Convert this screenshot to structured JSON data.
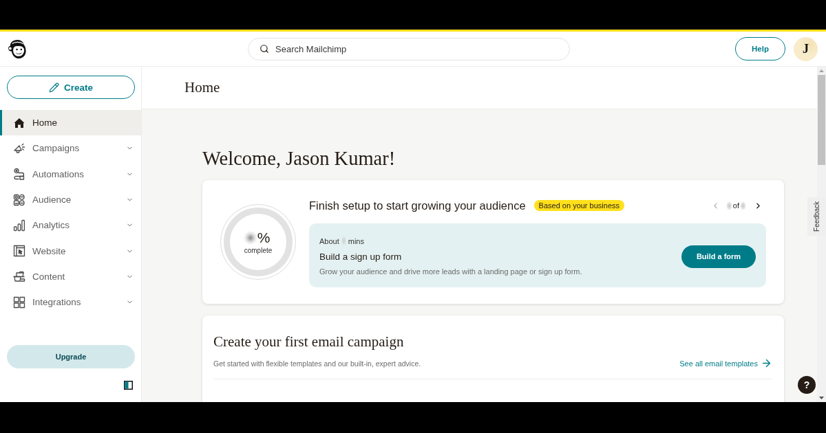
{
  "header": {
    "search": {
      "placeholder": "Search Mailchimp"
    },
    "help_button": "Help",
    "avatar": {
      "initial": "J"
    }
  },
  "sidebar": {
    "create_button": "Create",
    "items": [
      {
        "label": "Home",
        "selected": true,
        "expandable": false
      },
      {
        "label": "Campaigns",
        "selected": false,
        "expandable": true
      },
      {
        "label": "Automations",
        "selected": false,
        "expandable": true
      },
      {
        "label": "Audience",
        "selected": false,
        "expandable": true
      },
      {
        "label": "Analytics",
        "selected": false,
        "expandable": true
      },
      {
        "label": "Website",
        "selected": false,
        "expandable": true
      },
      {
        "label": "Content",
        "selected": false,
        "expandable": true
      },
      {
        "label": "Integrations",
        "selected": false,
        "expandable": true
      }
    ],
    "upgrade_button": "Upgrade"
  },
  "page": {
    "title": "Home",
    "welcome": "Welcome, Jason Kumar!",
    "setup_card": {
      "progress": {
        "unit": "%",
        "caption": "complete"
      },
      "title": "Finish setup to start growing your audience",
      "badge": "Based on your business",
      "pager": {
        "separator": "of",
        "buttons": [
          {
            "kind": "previous",
            "disabled": true
          },
          {
            "kind": "next",
            "disabled": false
          }
        ]
      },
      "task": {
        "time_prefix": "About",
        "time_suffix": "mins",
        "title": "Build a sign up form",
        "description": "Grow your audience and drive more leads with a landing page or sign up form.",
        "button": "Build a form"
      }
    },
    "campaign_card": {
      "title": "Create your first email campaign",
      "description": "Get started with flexible templates and our built-in, expert advice.",
      "link": "See all email templates"
    }
  },
  "feedback_tab": "Feedback",
  "help_bubble": "?"
}
